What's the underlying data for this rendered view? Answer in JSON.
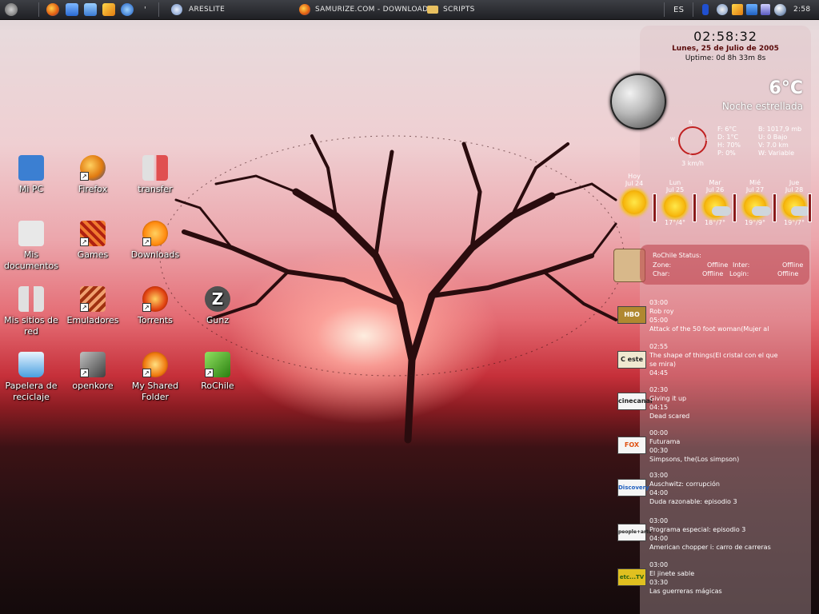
{
  "taskbar": {
    "tasks": [
      {
        "label": "ARESLITE",
        "icon": "areslite-icon"
      },
      {
        "label": "SAMURIZE.COM - DOWNLOAD...",
        "icon": "firefox-icon"
      },
      {
        "label": "SCRIPTS",
        "icon": "folder-icon"
      }
    ],
    "language": "ES",
    "clock": "2:58"
  },
  "desktop_icons": [
    {
      "label": "Mi PC",
      "icon": "my-computer-icon",
      "shortcut": false,
      "color": "#3b7fd2"
    },
    {
      "label": "Firefox",
      "icon": "firefox-icon",
      "shortcut": true,
      "color": "#e07a10"
    },
    {
      "label": "transfer",
      "icon": "transfer-icon",
      "shortcut": false,
      "color": "#d0d0d0"
    },
    {
      "label": "Mis documentos",
      "icon": "documents-icon",
      "shortcut": false,
      "color": "#e0e0e0"
    },
    {
      "label": "Games",
      "icon": "games-icon",
      "shortcut": true,
      "color": "#d0461a"
    },
    {
      "label": "Downloads",
      "icon": "downloads-icon",
      "shortcut": true,
      "color": "#ff9a20"
    },
    {
      "label": "Mis sitios de red",
      "icon": "network-icon",
      "shortcut": false,
      "color": "#cfcfcf"
    },
    {
      "label": "Emuladores",
      "icon": "emulators-icon",
      "shortcut": true,
      "color": "#c0501f"
    },
    {
      "label": "Torrents",
      "icon": "torrents-icon",
      "shortcut": true,
      "color": "#e04010"
    },
    {
      "label": "Gunz",
      "icon": "gunz-icon",
      "shortcut": false,
      "color": "#505050"
    },
    {
      "label": "Papelera de reciclaje",
      "icon": "recycle-bin-icon",
      "shortcut": false,
      "color": "#4aa0e0"
    },
    {
      "label": "openkore",
      "icon": "openkore-icon",
      "shortcut": true,
      "color": "#808080"
    },
    {
      "label": "My Shared Folder",
      "icon": "shared-folder-icon",
      "shortcut": true,
      "color": "#f0801a"
    },
    {
      "label": "RoChile",
      "icon": "rochile-icon",
      "shortcut": true,
      "color": "#40a020"
    }
  ],
  "clock": {
    "time": "02:58:32",
    "date": "Lunes, 25 de Julio de 2005",
    "uptime": "Uptime: 0d 8h 33m 8s"
  },
  "weather": {
    "temp": "6°C",
    "condition": "Noche estrellada",
    "compass": {
      "n": "N",
      "s": "S",
      "e": "E",
      "w": "W"
    },
    "wind": "3 km/h",
    "details_left": [
      "F:  6°C",
      "D:  1°C",
      "H:  70%",
      "P:  0%"
    ],
    "details_right": [
      "B:  1017,9 mb",
      "U:  0 Bajo",
      "V:  7.0 km",
      "W:  Variable"
    ],
    "forecast": [
      {
        "day": "Hoy",
        "date": "Jul 24",
        "temps": "",
        "icon": "sunny-icon"
      },
      {
        "day": "Lun",
        "date": "Jul 25",
        "temps": "17°/4°",
        "icon": "sunny-icon"
      },
      {
        "day": "Mar",
        "date": "Jul 26",
        "temps": "18°/7°",
        "icon": "partly-cloudy-icon"
      },
      {
        "day": "Mié",
        "date": "Jul 27",
        "temps": "19°/9°",
        "icon": "partly-cloudy-icon"
      },
      {
        "day": "Jue",
        "date": "Jul 28",
        "temps": "19°/7°",
        "icon": "partly-cloudy-icon"
      }
    ]
  },
  "rochile": {
    "title": "RoChile Status:",
    "zone_label": "Zone:",
    "zone": "Offline",
    "inter_label": "Inter:",
    "inter": "Offline",
    "char_label": "Char:",
    "char": "Offline",
    "login_label": "Login:",
    "login": "Offline"
  },
  "tv_guide": [
    {
      "channel": "HBO",
      "color": "#b08830",
      "lines": [
        "03:00",
        "Rob roy",
        "05:00",
        "Attack of the 50 foot woman(Mujer al"
      ]
    },
    {
      "channel": "C este",
      "color": "#e8a010",
      "lines": [
        "02:55",
        "The shape of things(El cristal con el que",
        "se mira)",
        "04:45"
      ]
    },
    {
      "channel": "cinecanal",
      "color": "#c02020",
      "lines": [
        "02:30",
        "Giving it up",
        "04:15",
        "Dead scared"
      ]
    },
    {
      "channel": "FOX",
      "color": "#e05010",
      "lines": [
        "00:00",
        "Futurama",
        "00:30",
        "Simpsons, the(Los simpson)"
      ]
    },
    {
      "channel": "Discovery",
      "color": "#2060c0",
      "lines": [
        "03:00",
        "Auschwitz: corrupción",
        "04:00",
        "Duda razonable: episodio 3"
      ]
    },
    {
      "channel": "people+arts",
      "color": "#303030",
      "lines": [
        "03:00",
        "Programa especial: episodio 3",
        "04:00",
        "American chopper i: carro de carreras"
      ]
    },
    {
      "channel": "etc...TV",
      "color": "#40a020",
      "lines": [
        "03:00",
        "El jinete sable",
        "03:30",
        "Las guerreras mágicas"
      ]
    }
  ]
}
